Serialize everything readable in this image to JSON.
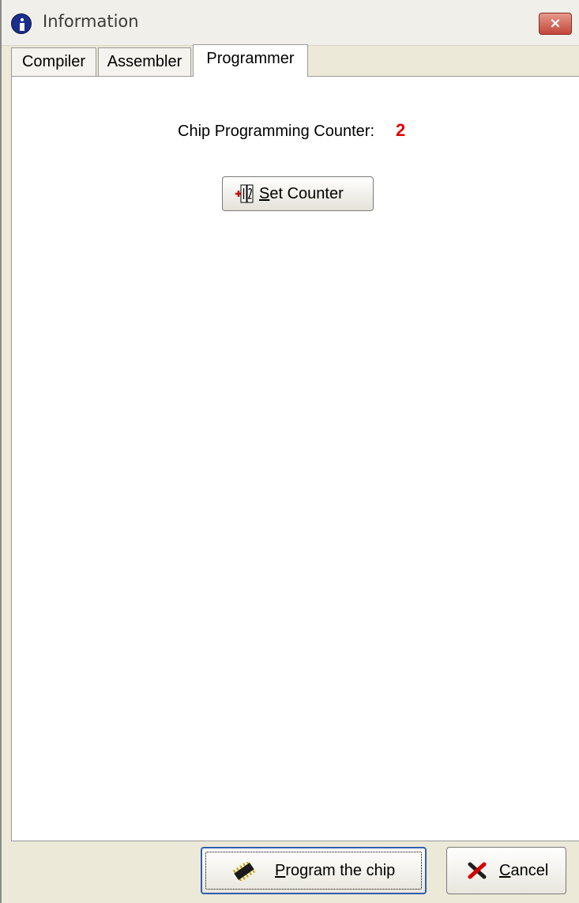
{
  "window": {
    "title": "Information",
    "close_label": "×"
  },
  "tabs": [
    {
      "label": "Compiler",
      "active": false
    },
    {
      "label": "Assembler",
      "active": false
    },
    {
      "label": "Programmer",
      "active": true
    }
  ],
  "programmer": {
    "counter_label": "Chip Programming Counter:",
    "counter_value": "2",
    "counter_value_color": "#e10000",
    "set_counter_accel": "S",
    "set_counter_rest": "et Counter",
    "set_counter_icon": "add-counter-icon"
  },
  "footer": {
    "program_accel": "P",
    "program_rest": "rogram the chip",
    "program_icon": "chip-icon",
    "cancel_accel": "C",
    "cancel_rest": "ancel",
    "cancel_icon": "x-icon"
  }
}
